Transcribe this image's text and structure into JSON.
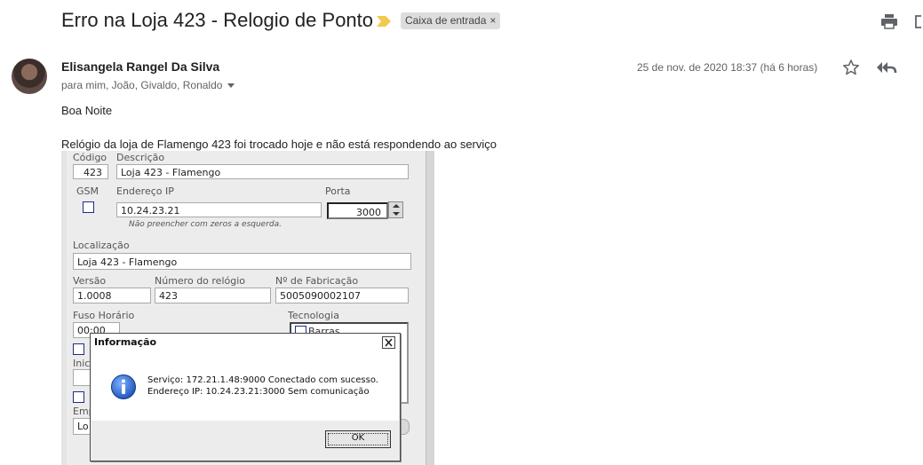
{
  "email": {
    "subject": "Erro na Loja 423 - Relogio de Ponto",
    "label": "Caixa de entrada",
    "label_close": "×",
    "sender": "Elisangela Rangel Da Silva",
    "recipients": "para mim, João, Givaldo, Ronaldo",
    "date": "25 de nov. de 2020 18:37 (há 6 horas)",
    "body": [
      "Boa Noite",
      "Relógio da loja de Flamengo 423 foi trocado hoje e não está respondendo ao serviço"
    ],
    "icons": {
      "importance": "importance-marker-icon",
      "print": "print-icon",
      "new_window": "open-new-window-icon",
      "star": "star-icon",
      "reply_all": "reply-all-icon"
    },
    "colors": {
      "importance": "#f2c94c",
      "chip": "#dddddd"
    }
  },
  "form": {
    "codigo_label": "Código",
    "codigo_value": "423",
    "descricao_label": "Descrição",
    "descricao_value": "Loja 423 - Flamengo",
    "gsm_label": "GSM",
    "ip_label": "Endereço IP",
    "ip_value": "10.24.23.21",
    "porta_label": "Porta",
    "porta_value": "3000",
    "ip_hint": "Não preencher com zeros a esquerda.",
    "localizacao_label": "Localização",
    "localizacao_value": "Loja 423 - Flamengo",
    "versao_label": "Versão",
    "versao_value": "1.0008",
    "numero_label": "Número do relógio",
    "numero_value": "423",
    "fabricacao_label": "Nº de Fabricação",
    "fabricacao_value": "5005090002107",
    "fuso_label": "Fuso Horário",
    "fuso_value": "00:00",
    "tecnologia_label": "Tecnologia",
    "tecnologia_option": "Barras",
    "partial_label_1": "Inic",
    "partial_label_2": "Emp",
    "partial_value_1": "Lo"
  },
  "dialog": {
    "title": "Informação",
    "close": "×",
    "line1": "Serviço: 172.21.1.48:9000 Conectado com sucesso.",
    "line2": "Endereço IP: 10.24.23.21:3000 Sem comunicação",
    "ok": "OK",
    "icon": "info-icon"
  }
}
